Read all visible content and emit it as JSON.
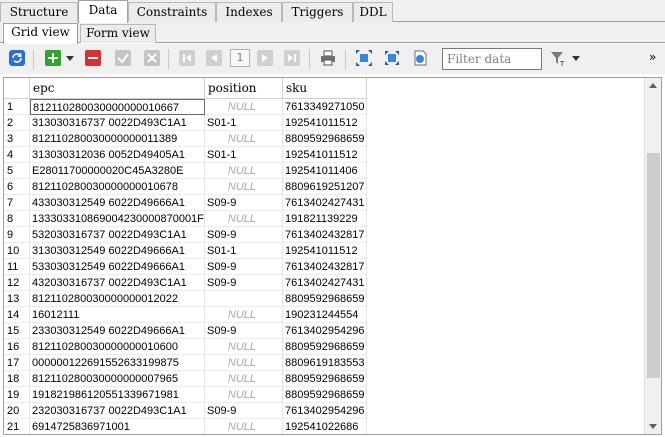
{
  "top_tabs": [
    "Structure",
    "Data",
    "Constraints",
    "Indexes",
    "Triggers",
    "DDL"
  ],
  "active_top_tab": "Data",
  "sub_tabs": [
    "Grid view",
    "Form view"
  ],
  "active_sub_tab": "Grid view",
  "toolbar": {
    "page_number": "1",
    "filter_placeholder": "Filter data",
    "more": "»"
  },
  "colors": {
    "add": "#2ea52e",
    "delete": "#d83030",
    "refresh": "#2a6fd6",
    "null_text": "#a8a8a8"
  },
  "table": {
    "columns": [
      "epc",
      "position",
      "sku"
    ],
    "null_label": "NULL",
    "rows": [
      [
        "1",
        "812110280030000000010667",
        null,
        "7613349271050"
      ],
      [
        "2",
        "313030316737 0022D493C1A1",
        "S01-1",
        "192541011512"
      ],
      [
        "3",
        "812110280030000000011389",
        null,
        "8809592968659"
      ],
      [
        "4",
        "313030312036 0052D49405A1",
        "S01-1",
        "192541011512"
      ],
      [
        "5",
        "E28011700000020C45A3280E",
        null,
        "192541011406"
      ],
      [
        "6",
        "812110280030000000010678",
        null,
        "8809619251207"
      ],
      [
        "7",
        "433030312549 6022D49666A1",
        "S09-9",
        "7613402427431"
      ],
      [
        "8",
        "133303310869004230000870001F",
        null,
        "191821139229"
      ],
      [
        "9",
        "532030316737 0022D493C1A1",
        "S09-9",
        "7613402432817"
      ],
      [
        "10",
        "313030312549 6022D49666A1",
        "S01-1",
        "192541011512"
      ],
      [
        "11",
        "533030312549 6022D49666A1",
        "S09-9",
        "7613402432817"
      ],
      [
        "12",
        "432030316737 0022D493C1A1",
        "S09-9",
        "7613402427431"
      ],
      [
        "13",
        "812110280030000000012022",
        "",
        "8809592968659"
      ],
      [
        "14",
        "16012111",
        null,
        "190231244554"
      ],
      [
        "15",
        "233030312549 6022D49666A1",
        "S09-9",
        "7613402954296"
      ],
      [
        "16",
        "812110280030000000010600",
        null,
        "8809592968659"
      ],
      [
        "17",
        "000000122691552633199875",
        null,
        "8809619183553"
      ],
      [
        "18",
        "812110280030000000007965",
        null,
        "8809592968659"
      ],
      [
        "19",
        "191821986120551339671981",
        null,
        "8809592968659"
      ],
      [
        "20",
        "232030316737 0022D493C1A1",
        "S09-9",
        "7613402954296"
      ],
      [
        "21",
        "6914725836971001",
        null,
        "192541022686"
      ]
    ]
  }
}
